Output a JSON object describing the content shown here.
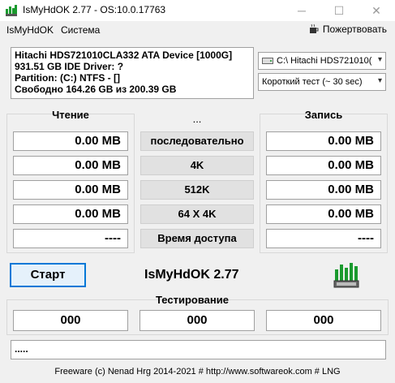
{
  "window": {
    "title": "IsMyHdOK 2.77 - OS:10.0.17763",
    "minimize_glyph": "─",
    "maximize_glyph": "☐",
    "close_glyph": "✕"
  },
  "menu": {
    "items": [
      "IsMyHdOK",
      "Система"
    ],
    "donate_label": "Пожертвовать"
  },
  "drive_info": {
    "line1": "Hitachi HDS721010CLA332 ATA Device [1000G]",
    "line2": "931.51 GB  IDE Driver: ?",
    "line3": "Partition: (C:) NTFS - []",
    "line4": "Свободно 164.26 GB из 200.39 GB"
  },
  "drive_select": {
    "value": "C:\\ Hitachi HDS721010("
  },
  "test_select": {
    "value": "Короткий тест (~ 30 sec)"
  },
  "read": {
    "title": "Чтение",
    "values": [
      "0.00 MB",
      "0.00 MB",
      "0.00 MB",
      "0.00 MB",
      "----"
    ]
  },
  "middle": {
    "title": "...",
    "buttons": [
      "последовательно",
      "4K",
      "512K",
      "64 X 4K",
      "Время доступа"
    ]
  },
  "write": {
    "title": "Запись",
    "values": [
      "0.00 MB",
      "0.00 MB",
      "0.00 MB",
      "0.00 MB",
      "----"
    ]
  },
  "start_label": "Старт",
  "app_name": "IsMyHdOK 2.77",
  "testing": {
    "title": "Тестирование",
    "values": [
      "000",
      "000",
      "000"
    ]
  },
  "status_text": ".....",
  "footer": "Freeware (c) Nenad Hrg 2014-2021 # http://www.softwareok.com     # LNG",
  "icons": {
    "app": "hdd-app-icon",
    "donate": "coffee-cup-icon",
    "hdd_logo": "hdd-bars-logo-icon"
  },
  "colors": {
    "accent": "#0078d7",
    "logo_green": "#1a9a2e"
  }
}
